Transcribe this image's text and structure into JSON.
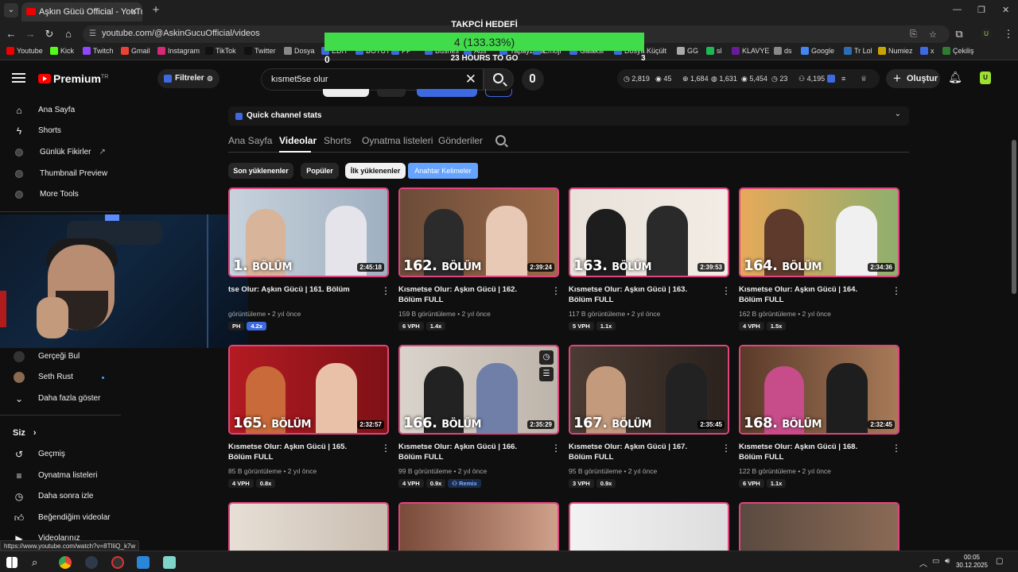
{
  "browser": {
    "tab_title": "Aşkın Gücü Official - YouTube",
    "url": "youtube.com/@AskinGucuOfficial/videos",
    "status_url": "https://www.youtube.com/watch?v=8TIliQ_k7w",
    "bookmarks": [
      "Youtube",
      "Kick",
      "Twitch",
      "Gmail",
      "Instagram",
      "TikTok",
      "Twitter",
      "Dosya",
      "EDIT",
      "BOTUT",
      "PP",
      "Busnes",
      "Ads",
      "Yapayzeka",
      "Emoji",
      "Galaksi",
      "Dosya Küçült",
      "GG",
      "sl",
      "KLAVYE",
      "ds",
      "Google",
      "Tr Lol",
      "Numiez",
      "x",
      "Çekiliş"
    ]
  },
  "overlay": {
    "title": "TAKPCİ HEDEFİ",
    "progress_text": "4 (133.33%)",
    "progress": 1.0,
    "left": "0",
    "middle": "23 HOURS TO GO",
    "right": "3"
  },
  "header": {
    "logo": "Premium",
    "logo_sup": "TR",
    "filters": "Filtreler",
    "search_query": "kısmet5se olur",
    "stats": [
      "2,819",
      "45",
      "1,684",
      "1,631",
      "5,454",
      "23",
      "4,195"
    ],
    "create": "Oluştur"
  },
  "sidebar": {
    "top": [
      "Ana Sayfa",
      "Shorts",
      "Günlük Fikirler",
      "Thumbnail Preview",
      "More Tools"
    ],
    "subs": [
      "Gerçeği Bul",
      "Seth Rust",
      "Daha fazla göster"
    ],
    "you_title": "Siz",
    "you": [
      "Geçmiş",
      "Oynatma listeleri",
      "Daha sonra izle",
      "Beğendiğim videolar",
      "Videolarınız"
    ]
  },
  "main": {
    "stats_bar": "Quick channel stats",
    "tabs": [
      "Ana Sayfa",
      "Videolar",
      "Shorts",
      "Oynatma listeleri",
      "Gönderiler"
    ],
    "chips": [
      "Son yüklenenler",
      "Popüler",
      "İlk yüklenenler",
      "Anahtar Kelimeler"
    ]
  },
  "videos": [
    {
      "ep": "1.",
      "title": "tse Olur: Aşkın Gücü | 161. Bölüm",
      "duration": "2:45:18",
      "meta": "görüntüleme • 2 yıl önce",
      "vph": "PH",
      "ratio": "4.2x"
    },
    {
      "ep": "162.",
      "title": "Kısmetse Olur: Aşkın Gücü | 162. Bölüm FULL",
      "duration": "2:39:24",
      "meta": "159 B görüntüleme • 2 yıl önce",
      "vph": "6 VPH",
      "ratio": "1.4x"
    },
    {
      "ep": "163.",
      "title": "Kısmetse Olur: Aşkın Gücü | 163. Bölüm FULL",
      "duration": "2:39:53",
      "meta": "117 B görüntüleme • 2 yıl önce",
      "vph": "5 VPH",
      "ratio": "1.1x"
    },
    {
      "ep": "164.",
      "title": "Kısmetse Olur: Aşkın Gücü | 164. Bölüm FULL",
      "duration": "2:34:36",
      "meta": "162 B görüntüleme • 2 yıl önce",
      "vph": "4 VPH",
      "ratio": "1.5x"
    },
    {
      "ep": "165.",
      "title": "Kısmetse Olur: Aşkın Gücü | 165. Bölüm FULL",
      "duration": "2:32:57",
      "meta": "85 B görüntüleme • 2 yıl önce",
      "vph": "4 VPH",
      "ratio": "0.8x"
    },
    {
      "ep": "166.",
      "title": "Kısmetse Olur: Aşkın Gücü | 166. Bölüm FULL",
      "duration": "2:35:29",
      "meta": "99 B görüntüleme • 2 yıl önce",
      "vph": "4 VPH",
      "ratio": "0.9x",
      "remix": "Remix"
    },
    {
      "ep": "167.",
      "title": "Kısmetse Olur: Aşkın Gücü | 167. Bölüm FULL",
      "duration": "2:35:45",
      "meta": "95 B görüntüleme • 2 yıl önce",
      "vph": "3 VPH",
      "ratio": "0.9x"
    },
    {
      "ep": "168.",
      "title": "Kısmetse Olur: Aşkın Gücü | 168. Bölüm FULL",
      "duration": "2:32:45",
      "meta": "122 B görüntüleme • 2 yıl önce",
      "vph": "6 VPH",
      "ratio": "1.1x"
    }
  ],
  "bolum_word": "BÖLÜM",
  "taskbar": {
    "time": "00:05",
    "date": "30.12.2025"
  },
  "colors": {
    "accent": "#3e6ae1",
    "thumb_border": "#e0457f",
    "overlay_green": "#40dc4a"
  }
}
